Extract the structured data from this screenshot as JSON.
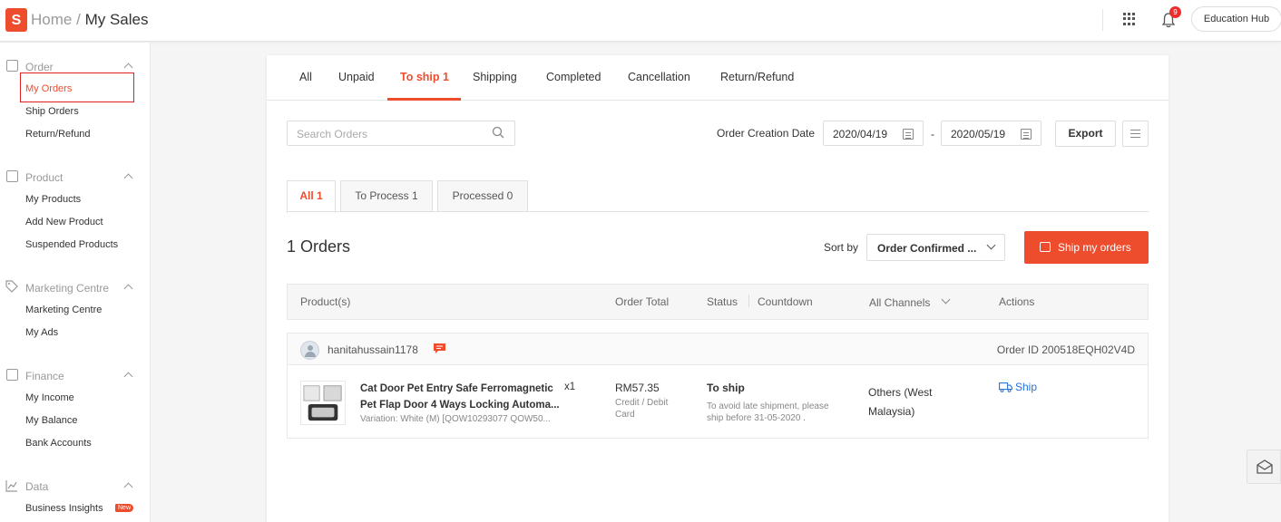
{
  "header": {
    "logo": "S",
    "breadcrumb_home": "Home",
    "breadcrumb_sep": "/",
    "breadcrumb_current": "My Sales",
    "notification_count": "9",
    "education_hub": "Education Hub"
  },
  "sidebar": {
    "sections": [
      {
        "title": "Order",
        "items": [
          "My Orders",
          "Ship Orders",
          "Return/Refund"
        ]
      },
      {
        "title": "Product",
        "items": [
          "My Products",
          "Add New Product",
          "Suspended Products"
        ]
      },
      {
        "title": "Marketing Centre",
        "items": [
          "Marketing Centre",
          "My Ads"
        ]
      },
      {
        "title": "Finance",
        "items": [
          "My Income",
          "My Balance",
          "Bank Accounts"
        ]
      },
      {
        "title": "Data",
        "items": [
          "Business Insights"
        ]
      }
    ],
    "new_badge": "New"
  },
  "tabs": [
    "All",
    "Unpaid",
    "To ship 1",
    "Shipping",
    "Completed",
    "Cancellation",
    "Return/Refund"
  ],
  "filters": {
    "search_placeholder": "Search Orders",
    "date_label": "Order Creation Date",
    "date_from": "2020/04/19",
    "date_sep": "-",
    "date_to": "2020/05/19",
    "export": "Export"
  },
  "subtabs": [
    "All 1",
    "To Process 1",
    "Processed 0"
  ],
  "list": {
    "count": "1 Orders",
    "sort_label": "Sort by",
    "sort_value": "Order Confirmed ...",
    "ship_button": "Ship my orders"
  },
  "table_headers": [
    "Product(s)",
    "Order Total",
    "Status",
    "Countdown",
    "All Channels",
    "Actions"
  ],
  "order": {
    "buyer": "hanitahussain1178",
    "order_id": "Order ID 200518EQH02V4D",
    "product_line1": "Cat Door Pet Entry Safe Ferromagnetic",
    "product_line2": "Pet Flap Door 4 Ways Locking Automa...",
    "qty": "x1",
    "variation": "Variation: White (M) [QOW10293077 QOW50...",
    "total": "RM57.35",
    "payment": "Credit / Debit Card",
    "status": "To ship",
    "status_note": "To avoid late shipment, please ship before 31-05-2020 .",
    "channel": "Others (West Malaysia)",
    "action": "Ship"
  },
  "colors": {
    "accent": "#ee4d2d",
    "link": "#2673dd"
  }
}
